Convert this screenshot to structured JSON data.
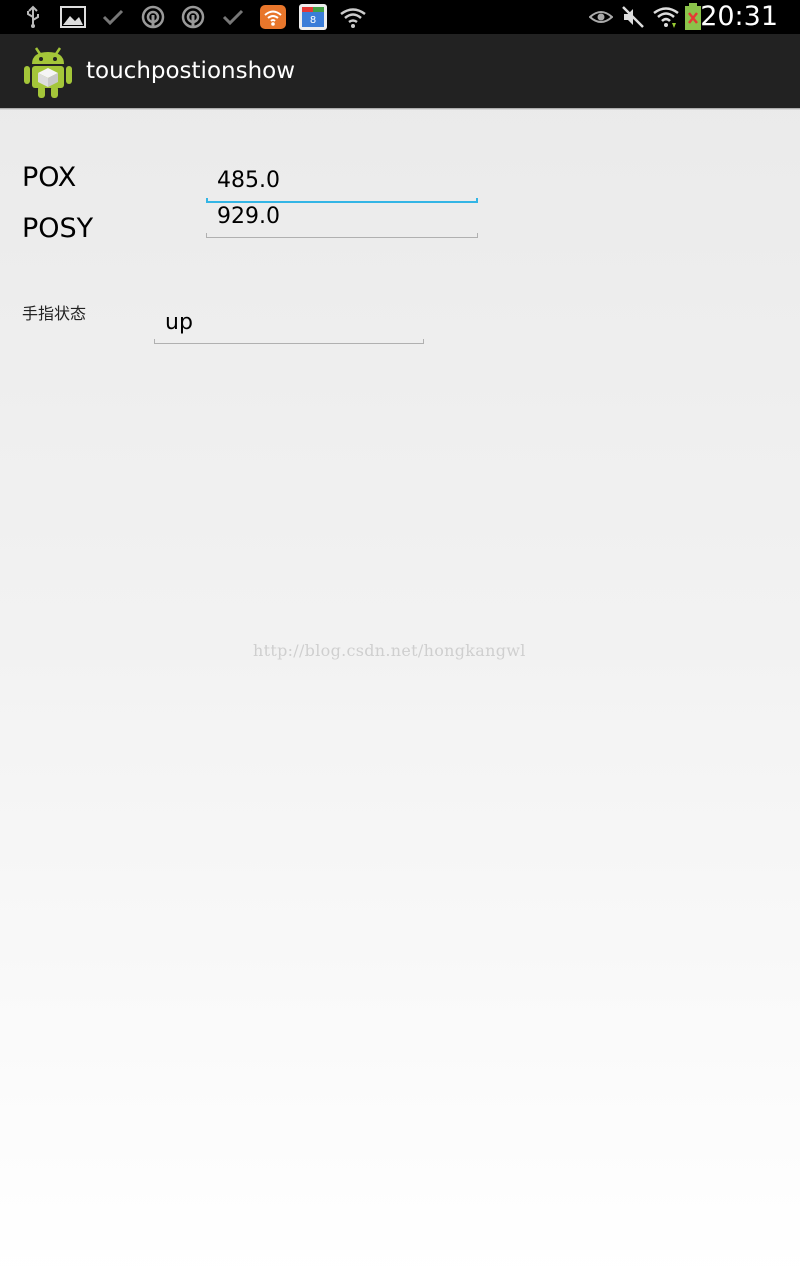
{
  "status_bar": {
    "time": "20:31",
    "left_icons": [
      "usb-icon",
      "gallery-icon",
      "check-icon",
      "podcast-icon",
      "podcast-icon",
      "check-icon",
      "wifi-app-icon",
      "store-app-icon",
      "wifi-question-icon"
    ],
    "right_icons": [
      "eye-icon",
      "mute-icon",
      "wifi-icon",
      "battery-icon"
    ]
  },
  "action_bar": {
    "title": "touchpostionshow",
    "icon": "android-icon"
  },
  "form": {
    "pox_label": "POX",
    "pox_value": "485.0",
    "posy_label": "POSY",
    "posy_value": "929.0",
    "state_label": "手指状态",
    "state_value": "up"
  },
  "watermark": "http://blog.csdn.net/hongkangwl",
  "colors": {
    "focus_accent": "#33b5e5",
    "action_bar_bg": "#222222",
    "status_bar_bg": "#000000"
  }
}
